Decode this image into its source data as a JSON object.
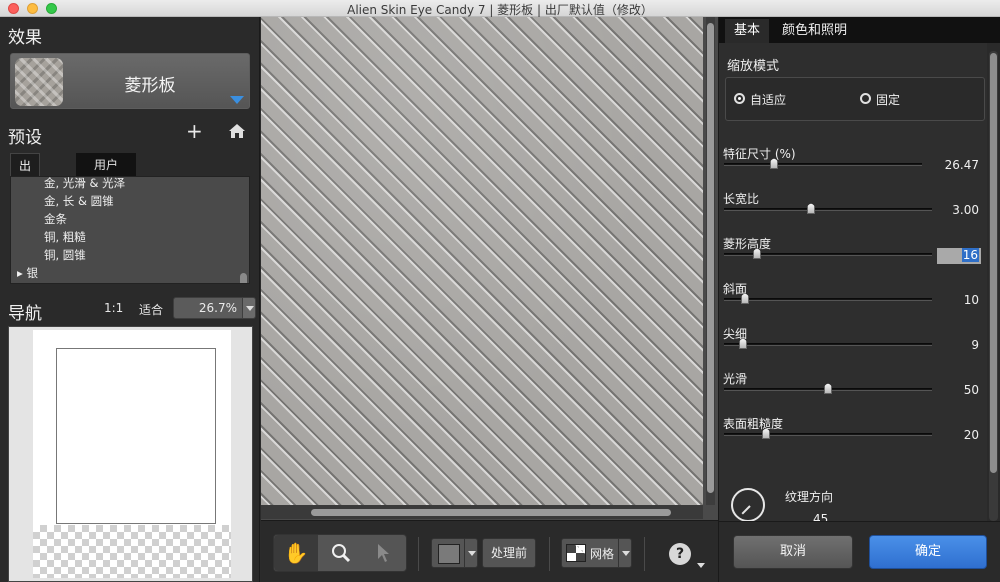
{
  "window": {
    "title": "Alien Skin Eye Candy 7 | 菱形板 | 出厂默认值（修改）"
  },
  "left": {
    "effect_title": "效果",
    "effect_name": "菱形板",
    "presets_title": "预设",
    "preset_tabs": [
      "出厂设置",
      "用户"
    ],
    "preset_items": [
      "金, 光滑 & 光泽",
      "金, 长 & 圆锥",
      "金条",
      "铜, 粗糙",
      "铜, 圆锥"
    ],
    "preset_group": "银",
    "nav_title": "导航",
    "nav_11": "1:1",
    "nav_fit": "适合",
    "zoom": "26.7%"
  },
  "toolbar": {
    "before_label": "处理前",
    "grid_label": "网格",
    "help_label": "?"
  },
  "right": {
    "tabs": [
      "基本",
      "颜色和照明"
    ],
    "mode_title": "缩放模式",
    "mode_options": [
      "自适应",
      "固定"
    ],
    "mode_selected": "自适应",
    "sliders": [
      {
        "label": "特征尺寸 (%)",
        "value": "26.47",
        "level": 0.25
      },
      {
        "label": "长宽比",
        "value": "3.00",
        "level": 0.42
      },
      {
        "label": "菱形高度",
        "value": "16",
        "level": 0.16,
        "editing": true
      },
      {
        "label": "斜面",
        "value": "10",
        "level": 0.1
      },
      {
        "label": "尖细",
        "value": "9",
        "level": 0.09
      },
      {
        "label": "光滑",
        "value": "50",
        "level": 0.5
      },
      {
        "label": "表面粗糙度",
        "value": "20",
        "level": 0.2
      }
    ],
    "dial_label": "纹理方向",
    "dial_value": "45",
    "cancel_label": "取消",
    "ok_label": "确定"
  },
  "colors": {
    "accent": "#2f6fd0",
    "panel": "#2a2a2a"
  }
}
